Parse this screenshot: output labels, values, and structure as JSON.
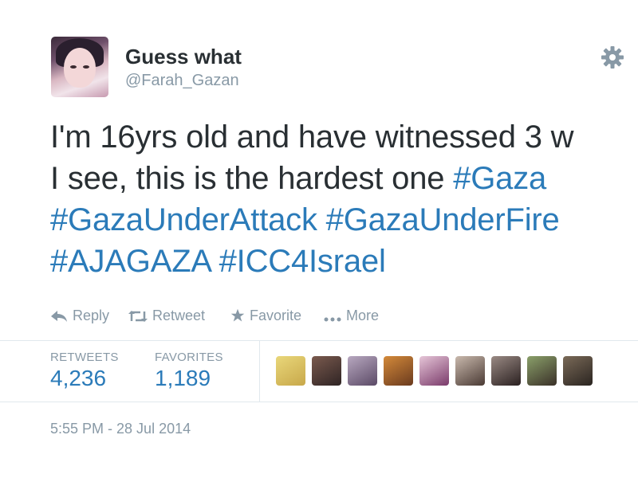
{
  "tweet": {
    "display_name": "Guess what",
    "handle": "@Farah_Gazan",
    "text_lines": [
      [
        {
          "t": "I'm 16yrs old and have witnessed 3 w",
          "tag": false
        }
      ],
      [
        {
          "t": "I see, this is the hardest one ",
          "tag": false
        },
        {
          "t": "#Gaza",
          "tag": true
        }
      ],
      [
        {
          "t": "#GazaUnderAttack",
          "tag": true
        },
        {
          "t": " ",
          "tag": false
        },
        {
          "t": "#GazaUnderFire",
          "tag": true
        }
      ],
      [
        {
          "t": "#AJAGAZA",
          "tag": true
        },
        {
          "t": " ",
          "tag": false
        },
        {
          "t": "#ICC4Israel",
          "tag": true
        }
      ]
    ],
    "timestamp": "5:55 PM - 28 Jul 2014"
  },
  "actions": {
    "reply": "Reply",
    "retweet": "Retweet",
    "favorite": "Favorite",
    "more": "More"
  },
  "stats": {
    "retweets_label": "RETWEETS",
    "retweets_value": "4,236",
    "favorites_label": "FAVORITES",
    "favorites_value": "1,189"
  },
  "favoriter_avatars": [
    {
      "name": "favoriter-avatar-1",
      "colors": [
        "#e9d77a",
        "#c8a84a"
      ]
    },
    {
      "name": "favoriter-avatar-2",
      "colors": [
        "#7a5a4e",
        "#2f2424"
      ]
    },
    {
      "name": "favoriter-avatar-3",
      "colors": [
        "#b8a8c0",
        "#5b4a66"
      ]
    },
    {
      "name": "favoriter-avatar-4",
      "colors": [
        "#d48a3a",
        "#6a3a1e"
      ]
    },
    {
      "name": "favoriter-avatar-5",
      "colors": [
        "#e6c6d8",
        "#7a3a6a"
      ]
    },
    {
      "name": "favoriter-avatar-6",
      "colors": [
        "#c9b9ad",
        "#4a3a34"
      ]
    },
    {
      "name": "favoriter-avatar-7",
      "colors": [
        "#9a8a84",
        "#2a2020"
      ]
    },
    {
      "name": "favoriter-avatar-8",
      "colors": [
        "#8aa06a",
        "#3a3028"
      ]
    },
    {
      "name": "favoriter-avatar-9",
      "colors": [
        "#7a6a58",
        "#2a2420"
      ]
    }
  ],
  "colors": {
    "text": "#292f33",
    "muted": "#8899a6",
    "link": "#2b7bb9",
    "border": "#e1e8ed"
  },
  "icons": {
    "settings": "gear-icon",
    "reply": "reply-icon",
    "retweet": "retweet-icon",
    "favorite": "star-icon",
    "more": "more-dots-icon"
  }
}
